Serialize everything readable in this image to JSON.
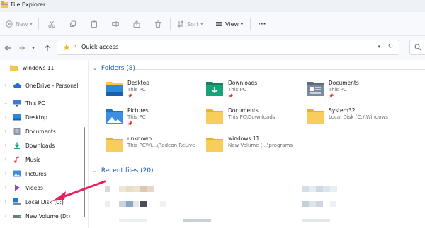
{
  "window": {
    "title": "File Explorer"
  },
  "toolbar": {
    "new_label": "New",
    "sort_label": "Sort",
    "view_label": "View",
    "more_label": "···"
  },
  "address": {
    "path": "Quick access",
    "separator": "›"
  },
  "sidebar": {
    "items": [
      {
        "label": "windows 11"
      },
      {
        "label": "OneDrive - Personal"
      },
      {
        "label": "This PC"
      },
      {
        "label": "Desktop"
      },
      {
        "label": "Documents"
      },
      {
        "label": "Downloads"
      },
      {
        "label": "Music"
      },
      {
        "label": "Pictures"
      },
      {
        "label": "Videos"
      },
      {
        "label": "Local Disk (C:)"
      },
      {
        "label": "New Volume (D:)"
      }
    ]
  },
  "folders_section": {
    "title": "Folders (8)",
    "tiles": [
      {
        "name": "Desktop",
        "sub": "This PC",
        "pinned": true
      },
      {
        "name": "Downloads",
        "sub": "This PC",
        "pinned": true
      },
      {
        "name": "Documents",
        "sub": "This PC",
        "pinned": true
      },
      {
        "name": "Pictures",
        "sub": "This PC",
        "pinned": true
      },
      {
        "name": "Documents",
        "sub": "This PC\\Downloads",
        "pinned": false
      },
      {
        "name": "System32",
        "sub": "Local Disk (C:)\\Windows",
        "pinned": false
      },
      {
        "name": "unknown",
        "sub": "This PC\\Vi...\\Radeon ReLive",
        "pinned": false
      },
      {
        "name": "windows 11",
        "sub": "New Volume (...\\programs",
        "pinned": false
      }
    ]
  },
  "recent_section": {
    "title": "Recent files (20)"
  },
  "colors": {
    "accent": "#1b5cb1",
    "folder": "#f5c64d",
    "arrow": "#e8205a"
  }
}
